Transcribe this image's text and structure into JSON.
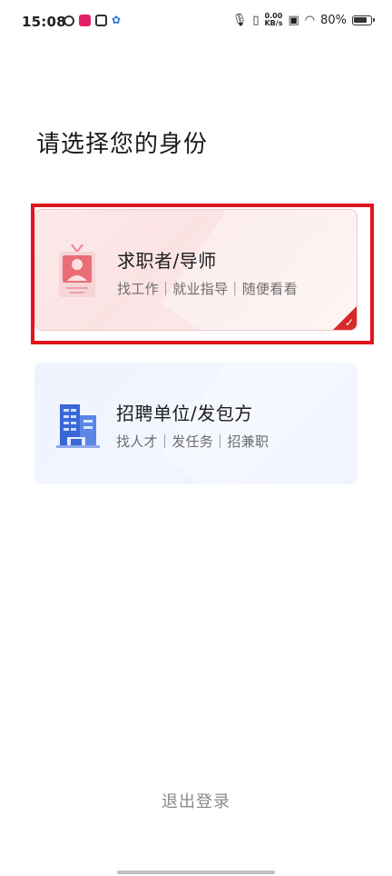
{
  "status_bar": {
    "time": "15:08",
    "net_speed_value": "0.00",
    "net_speed_unit": "KB/s",
    "battery_percent": "80%"
  },
  "page": {
    "title": "请选择您的身份"
  },
  "options": [
    {
      "title": "求职者/导师",
      "subtitle": "找工作｜就业指导｜随便看看",
      "selected": true,
      "icon": "id-badge-icon"
    },
    {
      "title": "招聘单位/发包方",
      "subtitle": "找人才｜发任务｜招兼职",
      "selected": false,
      "icon": "building-icon"
    }
  ],
  "footer": {
    "logout_label": "退出登录"
  },
  "colors": {
    "accent_red": "#e0161e",
    "jobseeker_card": "#fde9ea",
    "employer_card": "#eef3fe"
  }
}
